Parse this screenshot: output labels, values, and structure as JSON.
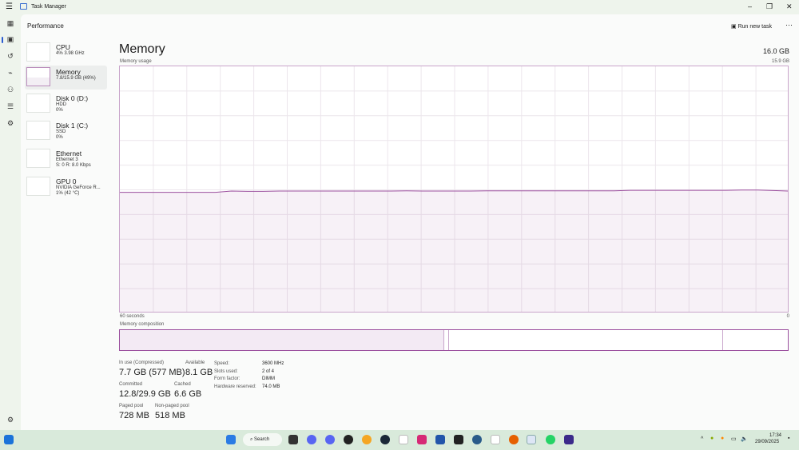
{
  "window": {
    "title": "Task Manager"
  },
  "header": {
    "section": "Performance",
    "run_new_task": "Run new task",
    "more": "⋯"
  },
  "sidebar": [
    {
      "name": "CPU",
      "line1": "4% 3.98 GHz",
      "line2": ""
    },
    {
      "name": "Memory",
      "line1": "7.8/15.9 GB (49%)",
      "line2": ""
    },
    {
      "name": "Disk 0 (D:)",
      "line1": "HDD",
      "line2": "0%"
    },
    {
      "name": "Disk 1 (C:)",
      "line1": "SSD",
      "line2": "0%"
    },
    {
      "name": "Ethernet",
      "line1": "Ethernet 3",
      "line2": "S: 0 R: 8.0 Kbps"
    },
    {
      "name": "GPU 0",
      "line1": "NVIDIA GeForce R...",
      "line2": "1% (42 °C)"
    }
  ],
  "memory": {
    "title": "Memory",
    "total": "16.0 GB",
    "usage_label": "Memory usage",
    "max_label": "15.9 GB",
    "time_left": "60 seconds",
    "time_right": "0",
    "composition_label": "Memory composition",
    "composition": {
      "in_use": 0.486,
      "modified": 0.007,
      "standby": 0.41
    },
    "usage_percent": [
      49,
      49,
      49,
      49,
      49,
      49,
      49,
      49.5,
      49.4,
      49.4,
      49.5,
      49.5,
      49.5,
      49.5,
      49.5,
      49.5,
      49.5,
      49.5,
      49.6,
      49.5,
      49.5,
      49.5,
      49.5,
      49.6,
      49.6,
      49.6,
      49.6,
      49.6,
      49.6,
      49.6,
      49.6,
      49.6,
      49.8,
      49.8,
      49.8,
      49.8,
      49.8,
      49.8,
      49.8,
      49.9,
      49.9,
      49.7,
      49.5
    ],
    "stats": [
      {
        "k": "In use (Compressed)",
        "v": "7.7 GB (577 MB)"
      },
      {
        "k": "Available",
        "v": "8.1 GB"
      },
      {
        "k": "Committed",
        "v": "12.8/29.9 GB"
      },
      {
        "k": "Cached",
        "v": "6.6 GB"
      },
      {
        "k": "Paged pool",
        "v": "728 MB"
      },
      {
        "k": "Non-paged pool",
        "v": "518 MB"
      }
    ],
    "details": [
      {
        "k": "Speed:",
        "v": "3600 MHz"
      },
      {
        "k": "Slots used:",
        "v": "2 of 4"
      },
      {
        "k": "Form factor:",
        "v": "DIMM"
      },
      {
        "k": "Hardware reserved:",
        "v": "74.0 MB"
      }
    ]
  },
  "taskbar": {
    "search": "Search",
    "time": "17:34",
    "date": "29/09/2025"
  },
  "colors": {
    "accent": "#9b4f9e",
    "fill": "#f3eef4"
  }
}
